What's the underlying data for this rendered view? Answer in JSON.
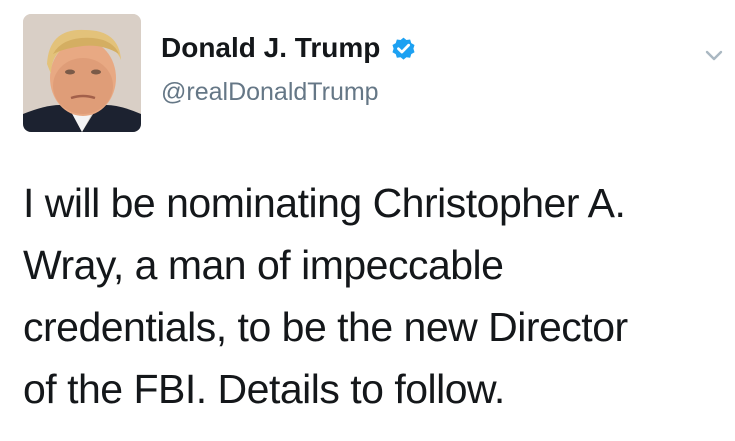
{
  "user": {
    "display_name": "Donald J. Trump",
    "handle": "@realDonaldTrump",
    "verified_icon": "verified-badge-icon",
    "avatar_icon": "profile-photo"
  },
  "menu": {
    "icon": "chevron-down-icon"
  },
  "tweet": {
    "lines": [
      "I will be nominating Christopher A.",
      "Wray, a man of impeccable",
      "credentials, to be the new Director",
      "of the FBI. Details to follow."
    ]
  },
  "colors": {
    "text": "#14171a",
    "secondary": "#657786",
    "verified_blue": "#1da1f2",
    "chevron": "#aab8c2"
  }
}
